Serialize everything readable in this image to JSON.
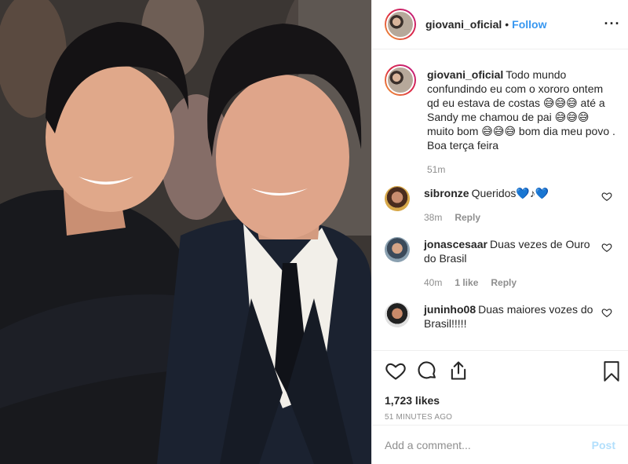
{
  "post": {
    "username": "giovani_oficial",
    "separator": "•",
    "follow_label": "Follow",
    "more_icon": "more-options-icon",
    "caption": {
      "username": "giovani_oficial",
      "text": "Todo mundo confundindo eu com o xororo ontem qd eu estava de costas 😅😅😅 até a Sandy me chamou de pai 😅😅😅 muito bom 😅😅😅 bom dia meu povo . Boa terça feira",
      "time": "51m"
    },
    "comments": [
      {
        "username": "sibronze",
        "text": "Queridos💙♪💙",
        "time": "38m",
        "likes": "",
        "reply": "Reply"
      },
      {
        "username": "jonascesaar",
        "text": "Duas vezes de Ouro do Brasil",
        "time": "40m",
        "likes": "1 like",
        "reply": "Reply"
      },
      {
        "username": "juninho08",
        "text": "Duas maiores vozes do Brasil!!!!!",
        "time": "",
        "likes": "",
        "reply": ""
      }
    ],
    "likes": "1,723 likes",
    "timestamp": "51 MINUTES AGO",
    "add_comment_placeholder": "Add a comment...",
    "post_label": "Post"
  },
  "colors": {
    "accent": "#3897f0",
    "post_disabled": "#b2dffc",
    "muted": "#8e8e8e"
  }
}
